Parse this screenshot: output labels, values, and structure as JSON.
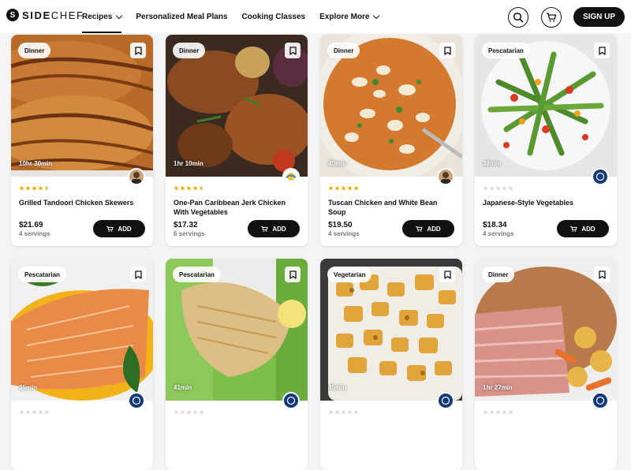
{
  "brand": {
    "name_bold": "SIDE",
    "name_light": "CHEF",
    "mark": "S"
  },
  "nav": {
    "items": [
      {
        "label": "Recipes",
        "dropdown": true,
        "active": true
      },
      {
        "label": "Personalized Meal Plans",
        "dropdown": false,
        "active": false
      },
      {
        "label": "Cooking Classes",
        "dropdown": false,
        "active": false
      },
      {
        "label": "Explore More",
        "dropdown": true,
        "active": false
      }
    ],
    "signup_label": "SIGN UP"
  },
  "colors": {
    "accent": "#111111",
    "star_filled": "#f2a900",
    "star_empty": "#d8d8d8",
    "background": "#f4f4f4"
  },
  "cards": [
    {
      "tag": "Dinner",
      "time": "10hr 30min",
      "rating": 4.5,
      "title": "Grilled Tandoori Chicken Skewers",
      "price": "$21.69",
      "servings": "4 servings",
      "add_label": "ADD",
      "avatar": "person-photo",
      "photo": "chicken"
    },
    {
      "tag": "Dinner",
      "time": "1hr 10min",
      "rating": 4.5,
      "title": "One-Pan Caribbean Jerk Chicken With Vegetables",
      "price": "$17.32",
      "servings": "6 servings",
      "add_label": "ADD",
      "avatar": "brand-logo",
      "photo": "jerk"
    },
    {
      "tag": "Dinner",
      "time": "40min",
      "rating": 5,
      "title": "Tuscan Chicken and White Bean Soup",
      "price": "$19.50",
      "servings": "4 servings",
      "add_label": "ADD",
      "avatar": "person-photo",
      "photo": "soup"
    },
    {
      "tag": "Pescatarian",
      "time": "38min",
      "rating": 0,
      "title": "Japanese-Style Vegetables",
      "price": "$18.34",
      "servings": "4 servings",
      "add_label": "ADD",
      "avatar": "sidechef-logo",
      "photo": "veg"
    },
    {
      "tag": "Pescatarian",
      "time": "35min",
      "rating": 0,
      "title": "",
      "price": "",
      "servings": "",
      "add_label": "",
      "avatar": "sidechef-logo",
      "photo": "salmon"
    },
    {
      "tag": "Pescatarian",
      "time": "41min",
      "rating": 0,
      "title": "",
      "price": "",
      "servings": "",
      "add_label": "",
      "avatar": "sidechef-logo",
      "photo": "fish"
    },
    {
      "tag": "Vegetarian",
      "time": "45min",
      "rating": 0,
      "title": "",
      "price": "",
      "servings": "",
      "add_label": "",
      "avatar": "sidechef-logo",
      "photo": "potato"
    },
    {
      "tag": "Dinner",
      "time": "1hr 27min",
      "rating": 0,
      "title": "",
      "price": "",
      "servings": "",
      "add_label": "",
      "avatar": "sidechef-logo",
      "photo": "ham"
    }
  ]
}
